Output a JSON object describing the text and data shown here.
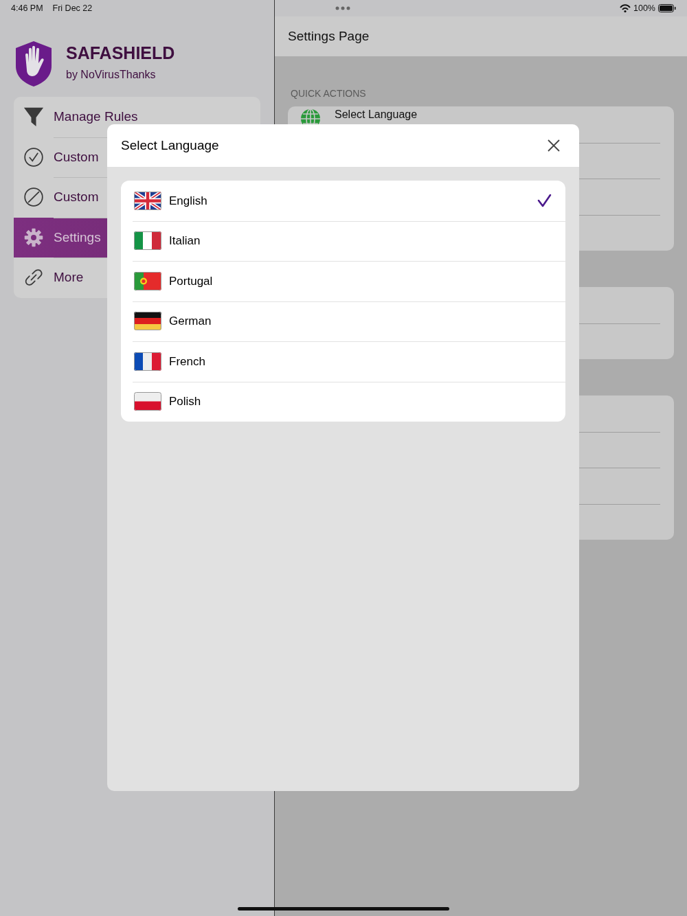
{
  "status_bar": {
    "time": "4:46 PM",
    "date": "Fri Dec 22",
    "battery": "100%"
  },
  "sidebar": {
    "app_title": "SAFASHIELD",
    "app_subtitle": "by NoVirusThanks",
    "items": [
      {
        "label": "Manage Rules",
        "kind": "funnel",
        "selected": false
      },
      {
        "label": "Custom",
        "kind": "check",
        "selected": false
      },
      {
        "label": "Custom",
        "kind": "block",
        "selected": false
      },
      {
        "label": "Settings",
        "kind": "gear",
        "selected": true
      },
      {
        "label": "More",
        "kind": "link",
        "selected": false
      }
    ]
  },
  "detail": {
    "title": "Settings Page",
    "section_label": "QUICK ACTIONS",
    "items": [
      {
        "label": "Select Language",
        "kind": "globe"
      }
    ]
  },
  "dialog": {
    "title": "Select Language",
    "languages": [
      {
        "label": "English",
        "kind": "uk",
        "selected": true
      },
      {
        "label": "Italian",
        "kind": "it",
        "selected": false
      },
      {
        "label": "Portugal",
        "kind": "pt",
        "selected": false
      },
      {
        "label": "German",
        "kind": "de",
        "selected": false
      },
      {
        "label": "French",
        "kind": "fr",
        "selected": false
      },
      {
        "label": "Polish",
        "kind": "pl",
        "selected": false
      }
    ]
  }
}
